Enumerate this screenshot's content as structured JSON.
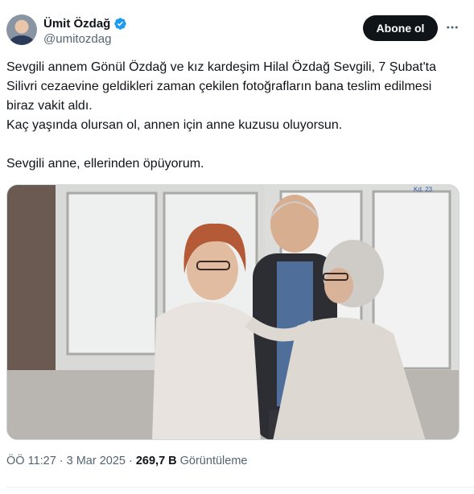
{
  "author": {
    "display_name": "Ümit Özdağ",
    "handle": "@umitozdag",
    "verified": true
  },
  "follow_button": {
    "label": "Abone ol"
  },
  "tweet": {
    "paragraphs": [
      "Sevgili annem Gönül Özdağ ve kız kardeşim Hilal Özdağ Sevgili, 7 Şubat'ta Silivri cezaevine geldikleri zaman çekilen fotoğrafların bana teslim edilmesi biraz vakit aldı.",
      "Kaç yaşında olursan ol, annen için anne kuzusu oluyorsun.",
      "Sevgili anne, ellerinden öpüyorum."
    ]
  },
  "media": {
    "photo_note": "Kd. 23"
  },
  "meta": {
    "time": "ÖÖ 11:27",
    "separator": "·",
    "date": "3 Mar 2025",
    "views_count": "269,7 B",
    "views_label": "Görüntüleme"
  },
  "colors": {
    "verified": "#1d9bf0",
    "button_bg": "#0f1419",
    "secondary_text": "#536471"
  },
  "icons": {
    "verified": "verified-badge-icon",
    "more": "more-dots-icon"
  }
}
